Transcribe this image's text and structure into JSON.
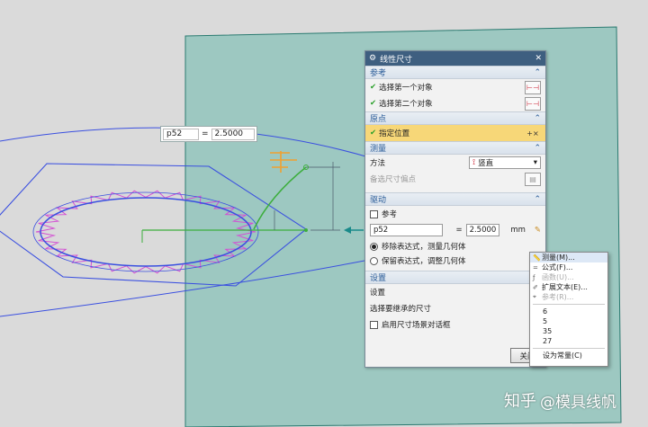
{
  "colors": {
    "sketch_plane": "#9dc8c1",
    "geometry": "#3a4fe0",
    "pattern": "#d34fd3",
    "accent": "#f0a030"
  },
  "float_input": {
    "name": "p52",
    "eq": "=",
    "value": "2.5000"
  },
  "dialog": {
    "title": "线性尺寸",
    "sections": {
      "reference": {
        "label": "参考",
        "first": "选择第一个对象",
        "second": "选择第二个对象"
      },
      "origin": {
        "label": "原点",
        "specify": "指定位置"
      },
      "measure": {
        "label": "测量",
        "method_label": "方法",
        "method_value": "竖直",
        "alt_point": "备选尺寸偏点"
      },
      "drive": {
        "label": "驱动",
        "reference_label": "参考",
        "name": "p52",
        "eq": "=",
        "value": "2.5000",
        "unit": "mm",
        "opt_remove": "移除表达式，测量几何体",
        "opt_keep": "保留表达式，调整几何体"
      },
      "settings": {
        "label": "设置",
        "settings_label": "设置",
        "inherit_label": "选择要继承的尺寸",
        "enable_scene": "启用尺寸场景对话框"
      }
    },
    "close_label": "关闭"
  },
  "menu": {
    "items": [
      "测量(M)...",
      "公式(F)...",
      "函数(U)...",
      "扩展文本(E)...",
      "参考(R)..."
    ],
    "values": [
      "6",
      "5",
      "35",
      "27"
    ],
    "set_const": "设为常量(C)"
  },
  "watermark": {
    "logo": "知乎",
    "text": "@模具线帆"
  }
}
